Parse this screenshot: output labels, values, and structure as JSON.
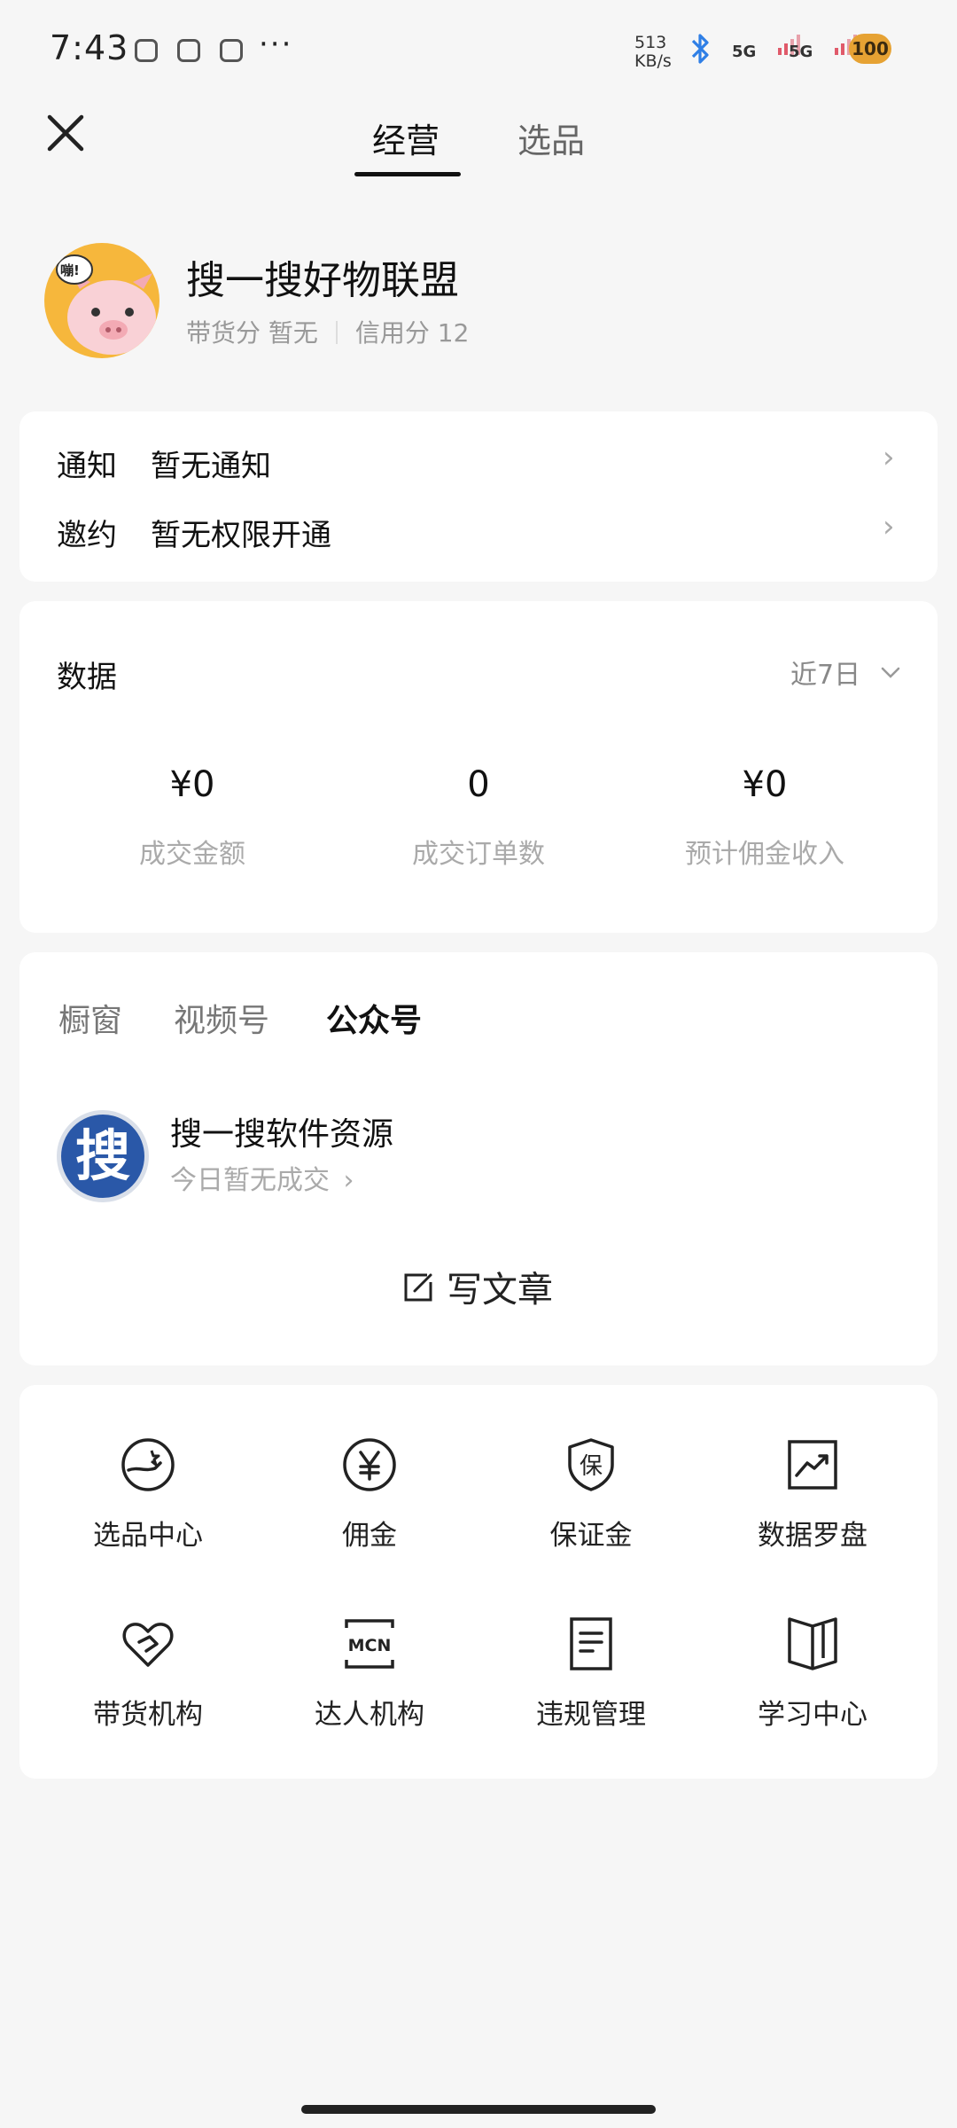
{
  "status_bar": {
    "time": "7:43",
    "dots": "···",
    "speed_value": "513",
    "speed_unit": "KB/s",
    "signal1": "5G",
    "signal2": "5G",
    "battery": "100"
  },
  "header": {
    "tabs": [
      {
        "label": "经营",
        "active": true
      },
      {
        "label": "选品",
        "active": false
      }
    ]
  },
  "profile": {
    "name": "搜一搜好物联盟",
    "avatar_bubble": "嘣!",
    "score_label": "带货分 暂无",
    "credit_label": "信用分 12"
  },
  "notices": [
    {
      "label": "通知",
      "value": "暂无通知"
    },
    {
      "label": "邀约",
      "value": "暂无权限开通"
    }
  ],
  "data_section": {
    "title": "数据",
    "range": "近7日",
    "stats": [
      {
        "value": "¥0",
        "label": "成交金额"
      },
      {
        "value": "0",
        "label": "成交订单数"
      },
      {
        "value": "¥0",
        "label": "预计佣金收入"
      }
    ]
  },
  "channels": {
    "tabs": [
      {
        "label": "橱窗",
        "active": false
      },
      {
        "label": "视频号",
        "active": false
      },
      {
        "label": "公众号",
        "active": true
      }
    ],
    "account_name": "搜一搜软件资源",
    "account_avatar_char": "搜",
    "account_status": "今日暂无成交",
    "write_label": "写文章"
  },
  "tools": [
    {
      "label": "选品中心",
      "icon": "product-hand-icon"
    },
    {
      "label": "佣金",
      "icon": "yen-circle-icon"
    },
    {
      "label": "保证金",
      "icon": "shield-deposit-icon"
    },
    {
      "label": "数据罗盘",
      "icon": "chart-trend-icon"
    },
    {
      "label": "带货机构",
      "icon": "heart-handshake-icon"
    },
    {
      "label": "达人机构",
      "icon": "mcn-icon"
    },
    {
      "label": "违规管理",
      "icon": "document-icon"
    },
    {
      "label": "学习中心",
      "icon": "book-icon"
    }
  ],
  "icon_text": {
    "deposit_char": "保",
    "mcn": "MCN"
  },
  "colors": {
    "avatar_bg": "#f6b73c",
    "battery": "#e6a233",
    "bluetooth": "#2f7fe6"
  }
}
